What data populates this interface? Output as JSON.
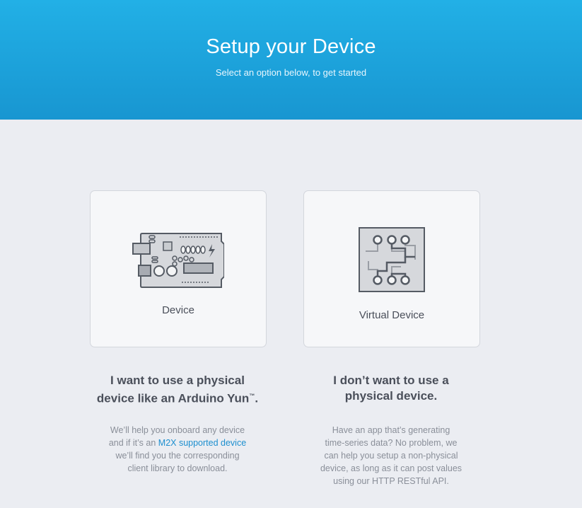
{
  "header": {
    "title": "Setup your Device",
    "subtitle": "Select an option below, to get started"
  },
  "options": [
    {
      "card_label": "Device",
      "icon": "arduino-board-icon",
      "heading_line1": "I want to use a physical",
      "heading_line2_text": "device like an Arduino Yun",
      "heading_tm": "™",
      "heading_end": ".",
      "desc_line1": "We’ll help you onboard any device",
      "desc_line2_pre": "and if it’s an ",
      "desc_link": "M2X supported device",
      "desc_line3": "we’ll find you the corresponding",
      "desc_line4": "client library to download."
    },
    {
      "card_label": "Virtual Device",
      "icon": "circuit-chip-icon",
      "heading_line1": "I don’t want to use a",
      "heading_line2": "physical device.",
      "desc_line1": "Have an app that’s generating",
      "desc_line2": "time-series data? No problem, we",
      "desc_line3": "can help you setup a non-physical",
      "desc_line4": "device, as long as it can post values",
      "desc_line5": "using our HTTP RESTful API."
    }
  ],
  "colors": {
    "header_top": "#22b0e6",
    "header_bottom": "#1896d1",
    "background": "#ebedf2",
    "link": "#1d8fcf"
  }
}
